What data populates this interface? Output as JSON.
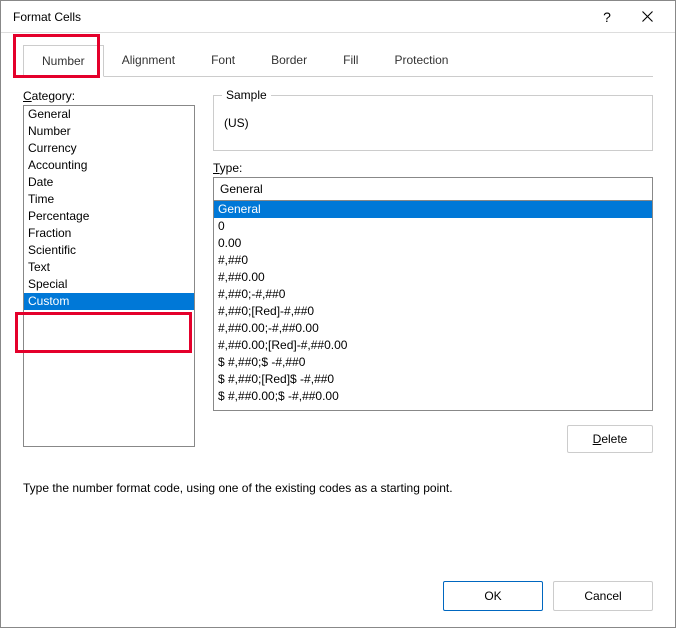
{
  "title": "Format Cells",
  "tabs": [
    "Number",
    "Alignment",
    "Font",
    "Border",
    "Fill",
    "Protection"
  ],
  "activeTab": 0,
  "categoryLabel": "Category:",
  "categories": [
    "General",
    "Number",
    "Currency",
    "Accounting",
    "Date",
    "Time",
    "Percentage",
    "Fraction",
    "Scientific",
    "Text",
    "Special",
    "Custom"
  ],
  "selectedCategory": 11,
  "sampleLabel": "Sample",
  "sampleValue": "(US)",
  "typeLabel": "Type:",
  "typeValue": "General",
  "typeFormats": [
    "General",
    "0",
    "0.00",
    "#,##0",
    "#,##0.00",
    "#,##0;-#,##0",
    "#,##0;[Red]-#,##0",
    "#,##0.00;-#,##0.00",
    "#,##0.00;[Red]-#,##0.00",
    "$ #,##0;$ -#,##0",
    "$ #,##0;[Red]$ -#,##0",
    "$ #,##0.00;$ -#,##0.00"
  ],
  "selectedFormat": 0,
  "deleteLabel": "Delete",
  "hint": "Type the number format code, using one of the existing codes as a starting point.",
  "okLabel": "OK",
  "cancelLabel": "Cancel"
}
